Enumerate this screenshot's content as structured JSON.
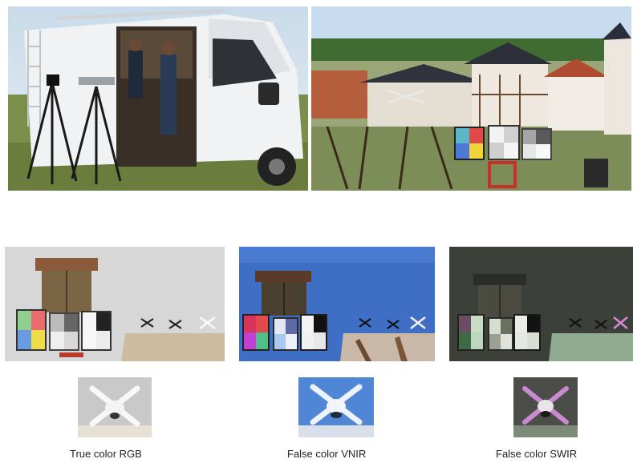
{
  "captions": {
    "rgb": "True color RGB",
    "vnir": "False color VNIR",
    "swir": "False color SWIR"
  },
  "photos": [
    {
      "id": "van-photo",
      "subject": "white van with tripods and cameras"
    },
    {
      "id": "scene-photo",
      "subject": "village buildings with color calibration targets"
    },
    {
      "id": "rgb-panel",
      "subject": "door, calibration boards and drones in true color"
    },
    {
      "id": "vnir-panel",
      "subject": "same scene in false color VNIR"
    },
    {
      "id": "swir-panel",
      "subject": "same scene in false color SWIR"
    },
    {
      "id": "rgb-drone",
      "subject": "drone close-up RGB"
    },
    {
      "id": "vnir-drone",
      "subject": "drone close-up VNIR"
    },
    {
      "id": "swir-drone",
      "subject": "drone close-up SWIR"
    }
  ],
  "colors": {
    "vnir_wall": "#3f6fc4",
    "swir_wall": "#3b4038",
    "rgb_wall": "#d7d7d7"
  }
}
